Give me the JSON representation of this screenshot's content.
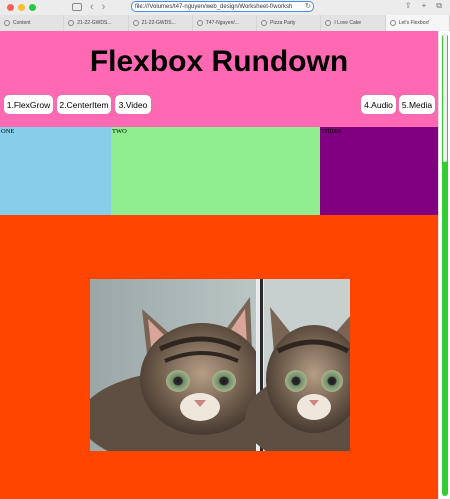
{
  "browser": {
    "url": "file:///Volumes/t47-nguyen/web_design/Worksheet-f/worksh",
    "tabs": [
      {
        "label": "Content"
      },
      {
        "label": "21-22-GWDS..."
      },
      {
        "label": "21-22-GWDS..."
      },
      {
        "label": "T47-Nguyen/..."
      },
      {
        "label": "Pizza Party"
      },
      {
        "label": "I Love Cake"
      },
      {
        "label": "Let's Flexbox!"
      }
    ]
  },
  "header": {
    "title": "Flexbox Rundown",
    "nav": [
      {
        "label": "1.FlexGrow"
      },
      {
        "label": "2.CenterItem"
      },
      {
        "label": "3.Video"
      },
      {
        "label": "4.Audio"
      },
      {
        "label": "5.Media"
      }
    ]
  },
  "boxes": {
    "one": "ONE",
    "two": "TWO",
    "three": "THREE"
  },
  "colors": {
    "header_bg": "#ff69b4",
    "page_bg": "#ff4500",
    "box_one": "#87ceeb",
    "box_two": "#90ee90",
    "box_three": "#800080",
    "scrollbar": "#32cd32"
  }
}
